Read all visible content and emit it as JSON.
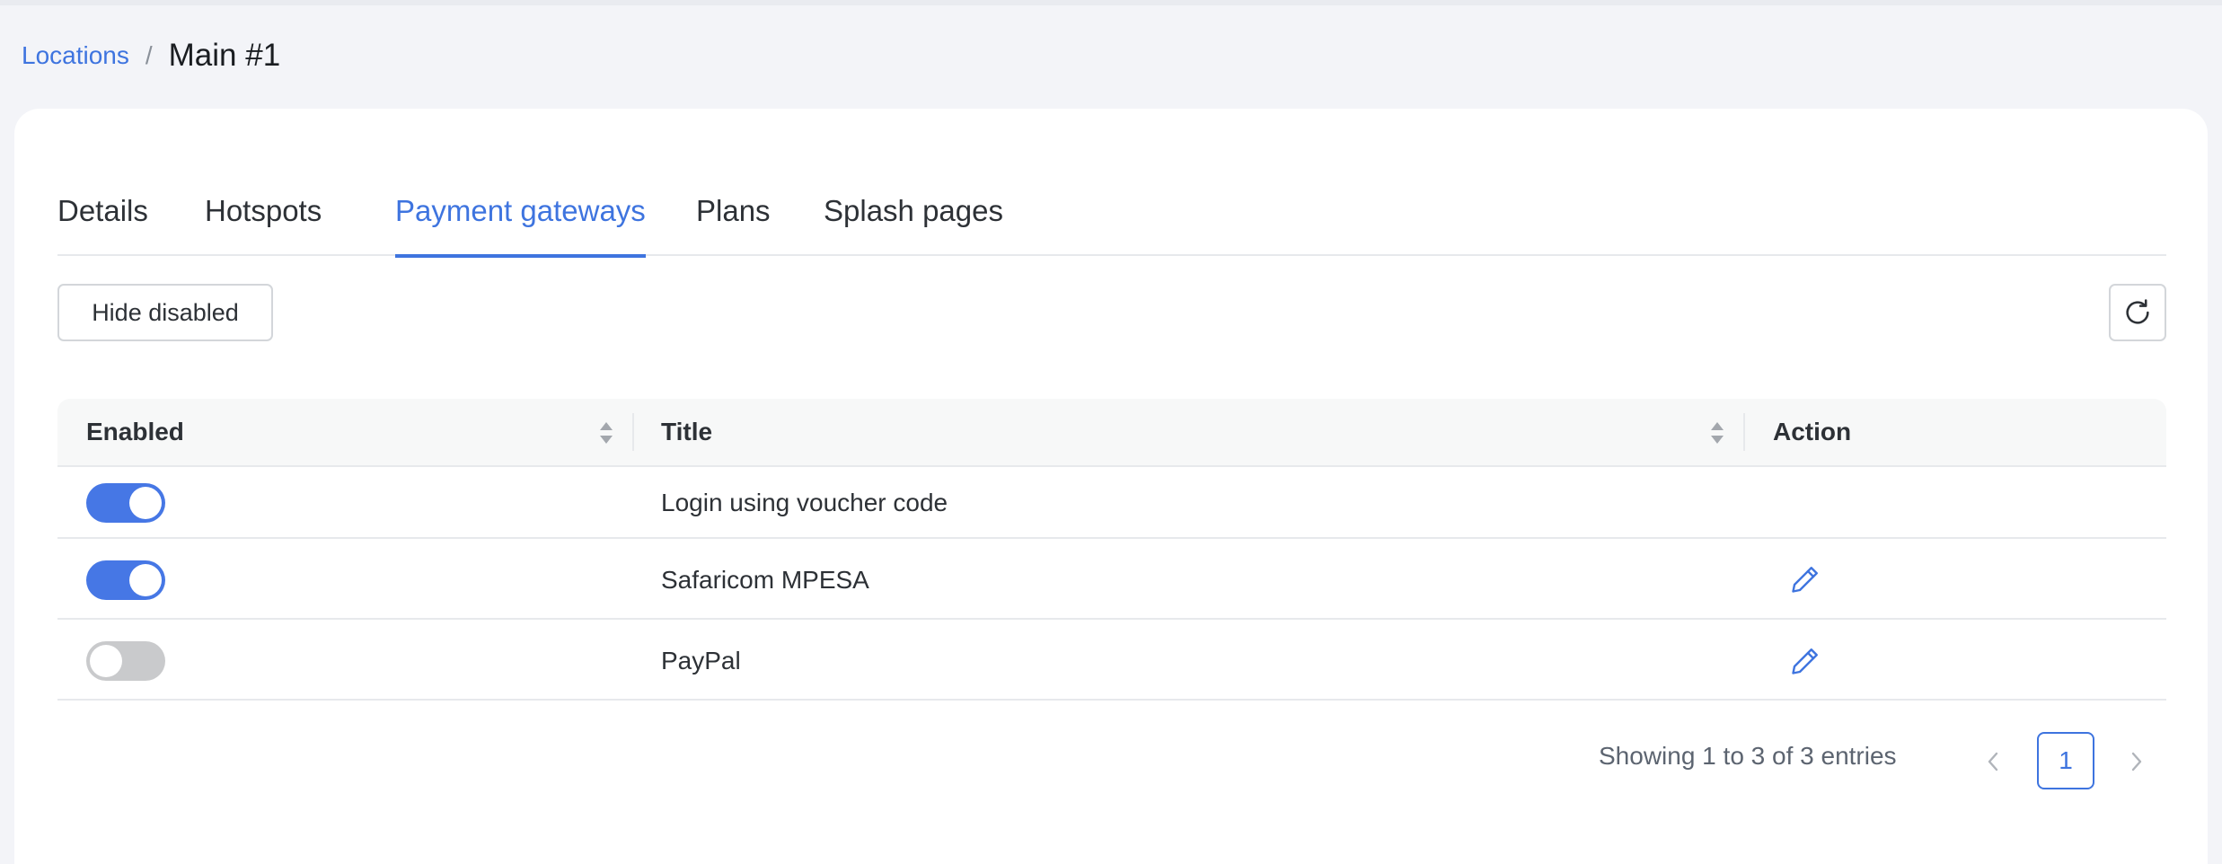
{
  "breadcrumb": {
    "parent": "Locations",
    "separator": "/",
    "current": "Main #1"
  },
  "tabs": [
    {
      "label": "Details",
      "active": false
    },
    {
      "label": "Hotspots",
      "active": false
    },
    {
      "label": "Payment gateways",
      "active": true
    },
    {
      "label": "Plans",
      "active": false
    },
    {
      "label": "Splash pages",
      "active": false
    }
  ],
  "toolbar": {
    "hide_disabled_label": "Hide disabled",
    "refresh_icon": "refresh-icon"
  },
  "table": {
    "columns": [
      "Enabled",
      "Title",
      "Action"
    ],
    "rows": [
      {
        "enabled": true,
        "title": "Login using voucher code",
        "editable": false
      },
      {
        "enabled": true,
        "title": "Safaricom MPESA",
        "editable": true
      },
      {
        "enabled": false,
        "title": "PayPal",
        "editable": true
      }
    ]
  },
  "footer": {
    "showing_text": "Showing 1 to 3 of 3 entries",
    "current_page": "1"
  },
  "colors": {
    "accent": "#3e74df",
    "toggle_on": "#4677e5",
    "toggle_off": "#c9cacc"
  }
}
